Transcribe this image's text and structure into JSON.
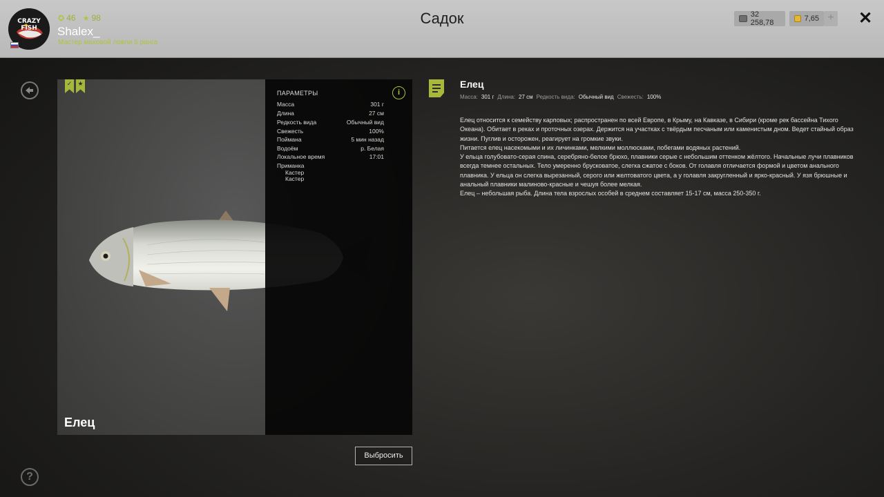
{
  "page_title": "Садок",
  "player": {
    "level": "46",
    "stars": "98",
    "name": "Shalex_",
    "rank": "Мастер маховой ловли 5 ранга",
    "logo_text": "CRAZY FISH"
  },
  "currency": {
    "silver": "32 258,78",
    "gold": "7,65",
    "plus_label": "+"
  },
  "close_label": "✕",
  "fish_card": {
    "name": "Елец",
    "params_title": "ПАРАМЕТРЫ",
    "info_label": "i",
    "params": [
      {
        "label": "Масса",
        "value": "301 г"
      },
      {
        "label": "Длина",
        "value": "27 см"
      },
      {
        "label": "Редкость вида",
        "value": "Обычный вид"
      },
      {
        "label": "Свежесть",
        "value": "100%"
      },
      {
        "label": "Поймана",
        "value": "5 мин назад"
      },
      {
        "label": "Водоём",
        "value": "р. Белая"
      },
      {
        "label": "Локальное время",
        "value": "17:01"
      }
    ],
    "bait_label": "Приманка",
    "baits": [
      "Кастер",
      "Кастер"
    ],
    "release_button": "Выбросить"
  },
  "description": {
    "title": "Елец",
    "meta": [
      {
        "label": "Масса:",
        "value": "301 г"
      },
      {
        "label": "Длина:",
        "value": "27 см"
      },
      {
        "label": "Редкость вида:",
        "value": "Обычный вид"
      },
      {
        "label": "Свежесть:",
        "value": "100%"
      }
    ],
    "paragraphs": [
      "Елец относится к семейству карповых; распространен по всей Европе, в Крыму, на Кавказе, в Сибири (кроме рек бассейна Тихого Океана). Обитает в реках и проточных озерах. Держится на участках с твёрдым песчаным или каменистым дном. Ведет стайный образ жизни. Пуглив и осторожен, реагирует на громкие звуки.",
      "Питается елец насекомыми и их личинками, мелкими моллюсками, побегами водяных растений.",
      "У ельца голубовато-серая спина, серебряно-белое брюхо, плавники серые с небольшим оттенком жёлтого. Начальные лучи плавников всегда темнее остальных. Тело умеренно брусковатое, слегка сжатое с боков. От голавля отличается формой и цветом анального плавника. У ельца он слегка вырезанный, серого или желтоватого цвета, а у голавля закругленный и ярко-красный. У язя брюшные и анальный плавники малиново-красные и чешуя более мелкая.",
      "Елец – небольшая рыба. Длина тела взрослых особей в среднем составляет 15-17 см, масса 250-350 г."
    ]
  }
}
